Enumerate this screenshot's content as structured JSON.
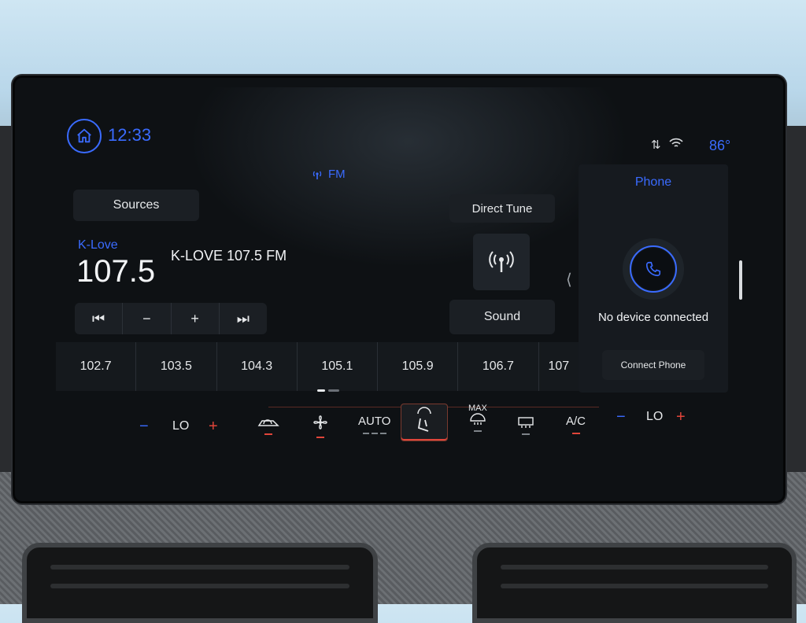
{
  "header": {
    "time": "12:33",
    "source_band": "FM",
    "outside_temp": "86°",
    "home_icon": "home-icon",
    "status_icons": [
      "data-transfer-icon",
      "wifi-icon"
    ]
  },
  "radio": {
    "sources_label": "Sources",
    "direct_tune_label": "Direct Tune",
    "sound_label": "Sound",
    "station_name": "K-Love",
    "frequency": "107.5",
    "station_title": "K-LOVE 107.5 FM",
    "transport": [
      "⏮",
      "−",
      "+",
      "⏭"
    ],
    "presets": [
      "102.7",
      "103.5",
      "104.3",
      "105.1",
      "105.9",
      "106.7",
      "107"
    ]
  },
  "phone": {
    "title": "Phone",
    "status": "No device connected",
    "connect_label": "Connect Phone"
  },
  "climate": {
    "left_temp": "LO",
    "right_temp": "LO",
    "auto_label": "AUTO",
    "max_label": "MAX",
    "ac_label": "A/C",
    "minus": "−",
    "plus": "+"
  },
  "colors": {
    "accent": "#3a6bff",
    "warning": "#e0453a",
    "screen_bg": "#0e1114"
  }
}
